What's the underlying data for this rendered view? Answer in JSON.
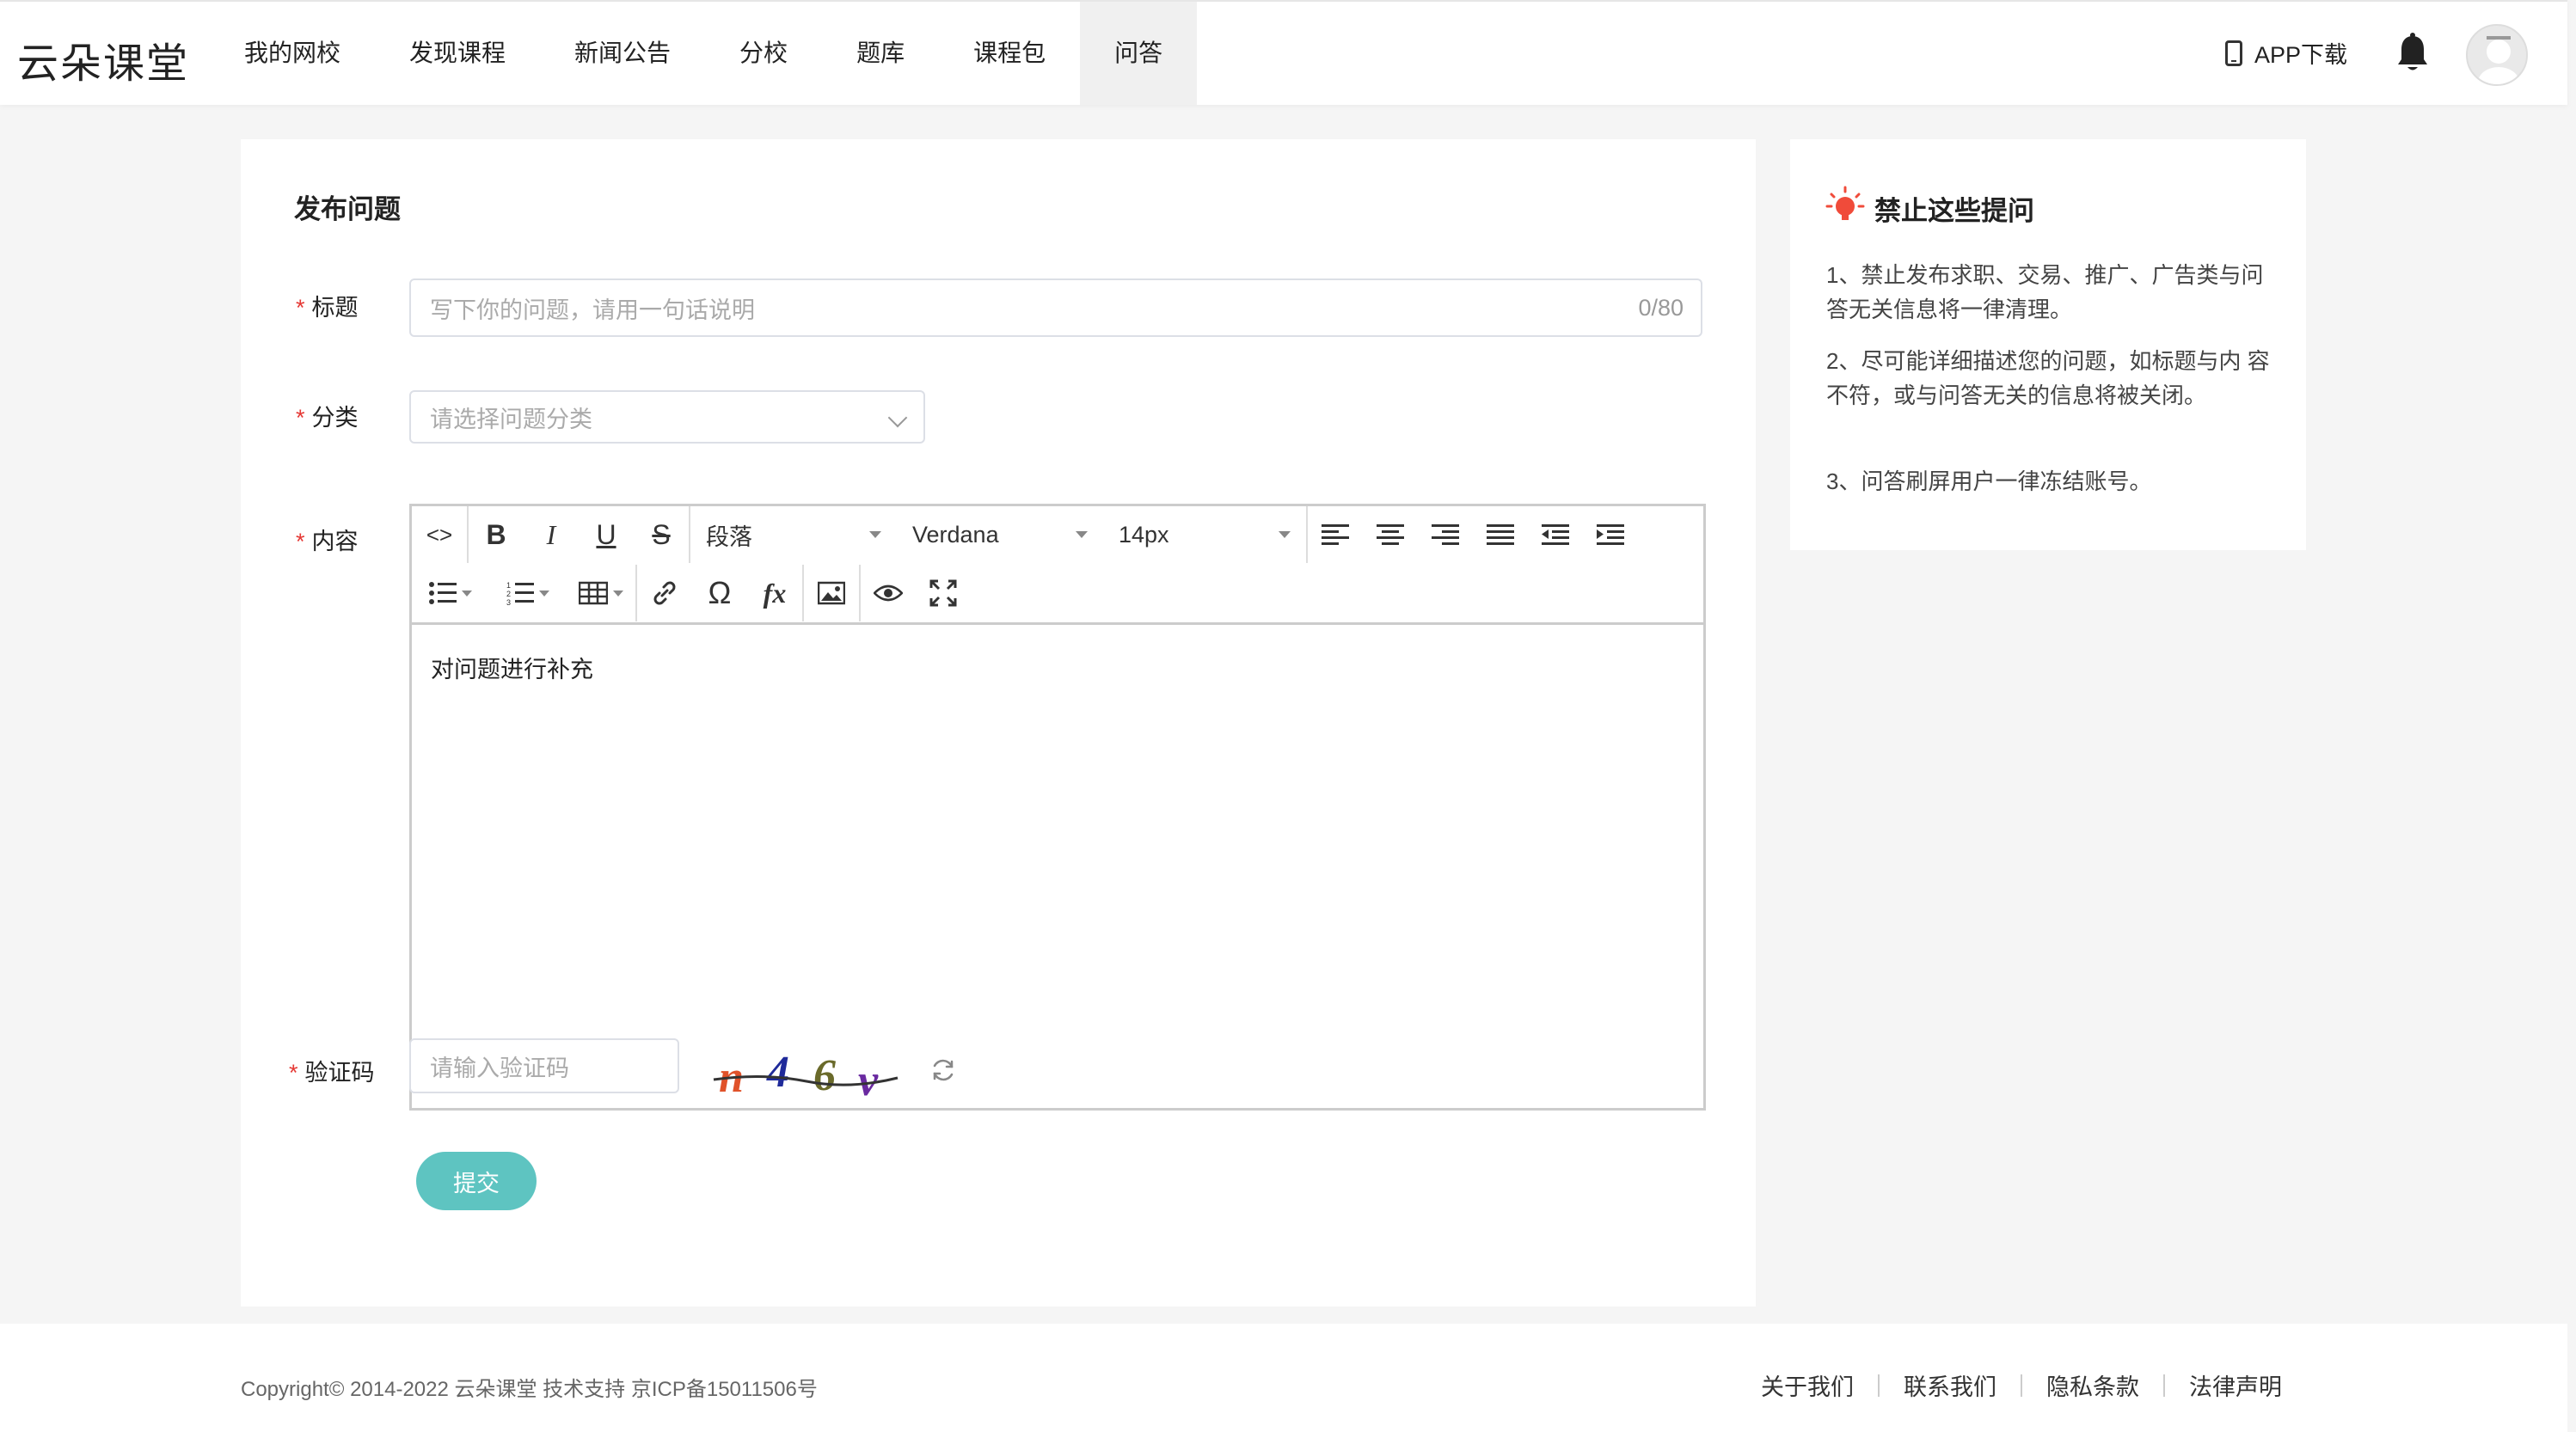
{
  "header": {
    "logo": "云朵课堂",
    "nav": [
      {
        "label": "我的网校"
      },
      {
        "label": "发现课程"
      },
      {
        "label": "新闻公告"
      },
      {
        "label": "分校"
      },
      {
        "label": "题库"
      },
      {
        "label": "课程包"
      },
      {
        "label": "问答",
        "active": true
      }
    ],
    "app_download": "APP下载"
  },
  "form": {
    "title": "发布问题",
    "title_field": {
      "label": "标题",
      "placeholder": "写下你的问题，请用一句话说明",
      "counter": "0/80"
    },
    "category_field": {
      "label": "分类",
      "placeholder": "请选择问题分类"
    },
    "content_field": {
      "label": "内容",
      "value": "对问题进行补充"
    },
    "editor": {
      "paragraph": "段落",
      "font": "Verdana",
      "size": "14px"
    },
    "captcha_field": {
      "label": "验证码",
      "placeholder": "请输入验证码",
      "captcha_text": "n46v"
    },
    "submit": "提交"
  },
  "side": {
    "title": "禁止这些提问",
    "rules": [
      "1、禁止发布求职、交易、推广、广告类与问答无关信息将一律清理。",
      "2、尽可能详细描述您的问题，如标题与内 容不符，或与问答无关的信息将被关闭。",
      "3、问答刷屏用户一律冻结账号。"
    ]
  },
  "footer": {
    "copyright": "Copyright© 2014-2022  云朵课堂 技术支持 京ICP备15011506号",
    "links": [
      "关于我们",
      "联系我们",
      "隐私条款",
      "法律声明"
    ]
  },
  "colors": {
    "accent": "#5ec4c1",
    "required": "#e53935",
    "bulb": "#f04b3a"
  }
}
